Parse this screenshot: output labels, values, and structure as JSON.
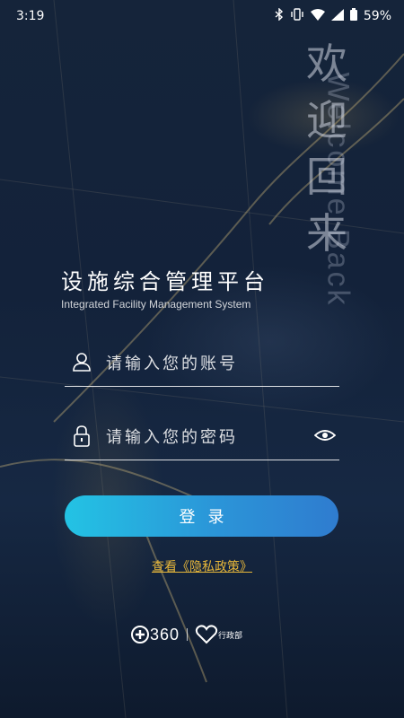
{
  "status_bar": {
    "time": "3:19",
    "battery": "59%"
  },
  "welcome": {
    "chars": [
      "欢",
      "迎",
      "回",
      "来"
    ],
    "english": "Welcome Back"
  },
  "header": {
    "title": "设施综合管理平台",
    "subtitle": "Integrated Facility Management System"
  },
  "form": {
    "account_placeholder": "请输入您的账号",
    "password_placeholder": "请输入您的密码",
    "login_label": "登录"
  },
  "privacy_link": "查看《隐私政策》",
  "branding": {
    "logo_360_text": "360",
    "partner_text": "行政部"
  },
  "colors": {
    "accent_gradient_start": "#23c3e4",
    "accent_gradient_end": "#2f7ccf",
    "link": "#e6b63a"
  }
}
